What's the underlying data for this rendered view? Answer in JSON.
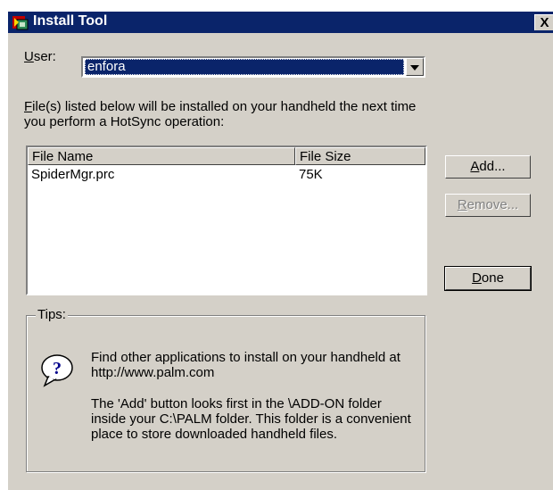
{
  "window": {
    "title": "Install Tool",
    "close_label": "X"
  },
  "user": {
    "label_key": "U",
    "label_rest": "ser:",
    "value": "enfora"
  },
  "info": {
    "key": "F",
    "rest": "ile(s) listed below will be installed on your handheld the next time you perform a HotSync operation:"
  },
  "file_list": {
    "columns": [
      "File Name",
      "File Size"
    ],
    "rows": [
      {
        "name": "SpiderMgr.prc",
        "size": "75K"
      }
    ]
  },
  "buttons": {
    "add": {
      "key": "A",
      "rest": "dd..."
    },
    "remove": {
      "key": "R",
      "rest": "emove..."
    },
    "done": {
      "key": "D",
      "rest": "one"
    }
  },
  "tips": {
    "label": "Tips:",
    "icon": "question-balloon-icon",
    "tip1": "Find other applications to install on your handheld at http://www.palm.com",
    "tip2": "The 'Add' button looks first in the \\ADD-ON folder inside your C:\\PALM folder. This folder is a convenient place to store downloaded handheld files."
  },
  "colors": {
    "titlebar": "#0a246a",
    "face": "#d4d0c8",
    "selection": "#0a246a"
  }
}
